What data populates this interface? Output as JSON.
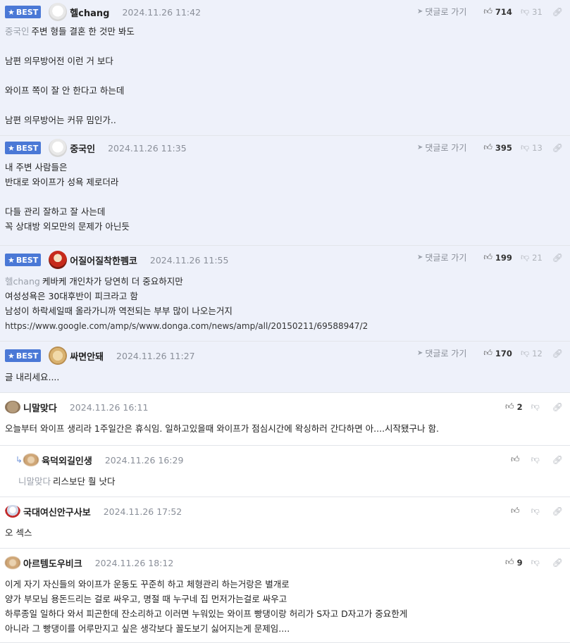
{
  "comments": [
    {
      "best": true,
      "badge": "BEST",
      "nickname": "헬chang",
      "time": "2024.11.26 11:42",
      "reply_label": "댓글로 가기",
      "up": "714",
      "down": "31",
      "avatar_icon": "white-dog-avatar",
      "lines": [
        {
          "mention": "중국인",
          "text": "주변 형들 결혼 한 것만 봐도"
        },
        {
          "mention": "",
          "text": ""
        },
        {
          "mention": "",
          "text": "남편 의무방어전 이런 거 보다"
        },
        {
          "mention": "",
          "text": ""
        },
        {
          "mention": "",
          "text": "와이프 쪽이 잘 안 한다고 하는데"
        },
        {
          "mention": "",
          "text": ""
        },
        {
          "mention": "",
          "text": "남편 의무방어는 커뮤 밈인가.."
        }
      ]
    },
    {
      "best": true,
      "badge": "BEST",
      "nickname": "중국인",
      "time": "2024.11.26 11:35",
      "reply_label": "댓글로 가기",
      "up": "395",
      "down": "13",
      "avatar_icon": "white-dog-avatar",
      "lines": [
        {
          "mention": "",
          "text": "내 주변 사람들은"
        },
        {
          "mention": "",
          "text": "반대로 와이프가 성욕 제로더라"
        },
        {
          "mention": "",
          "text": ""
        },
        {
          "mention": "",
          "text": "다들 관리 잘하고 잘 사는데"
        },
        {
          "mention": "",
          "text": "꼭 상대방 외모만의 문제가 아닌듯"
        }
      ]
    },
    {
      "best": true,
      "badge": "BEST",
      "nickname": "어질어질착한펨코",
      "time": "2024.11.26 11:55",
      "reply_label": "댓글로 가기",
      "up": "199",
      "down": "21",
      "avatar_icon": "red-hood-avatar",
      "lines": [
        {
          "mention": "헬chang",
          "text": "케바케 개인차가 당연히 더 중요하지만"
        },
        {
          "mention": "",
          "text": "여성성욕은 30대후반이 피크라고 함"
        },
        {
          "mention": "",
          "text": "남성이 하락세일때 올라가니까 역전되는 부부 많이 나오는거지"
        },
        {
          "mention": "",
          "text": "https://www.google.com/amp/s/www.donga.com/news/amp/all/20150211/69588947/2",
          "is_url": true
        }
      ]
    },
    {
      "best": true,
      "badge": "BEST",
      "nickname": "싸면안돼",
      "time": "2024.11.26 11:27",
      "reply_label": "댓글로 가기",
      "up": "170",
      "down": "12",
      "avatar_icon": "puppy-avatar",
      "lines": [
        {
          "mention": "",
          "text": "글 내리세요...."
        }
      ]
    },
    {
      "best": false,
      "nickname": "니말맞다",
      "time": "2024.11.26 16:11",
      "up": "2",
      "down": "",
      "avatar_icon": "brown-circle-avatar",
      "lines": [
        {
          "mention": "",
          "text": "오늘부터 와이프 생리라 1주일간은 휴식임. 일하고있을때 와이프가 점심시간에 왁싱하러 간다하면 아....시작됐구나 함."
        }
      ]
    },
    {
      "best": false,
      "is_reply": true,
      "nickname": "육덕외길인생",
      "time": "2024.11.26 16:29",
      "up": "",
      "down": "",
      "avatar_icon": "blurred-dog-avatar",
      "lines": [
        {
          "mention": "니말맞다",
          "text": "리스보단 훨 낫다"
        }
      ]
    },
    {
      "best": false,
      "nickname": "국대여신안구사보",
      "time": "2024.11.26 17:52",
      "up": "",
      "down": "",
      "avatar_icon": "cartoon-man-avatar",
      "lines": [
        {
          "mention": "",
          "text": "오 섹스"
        }
      ]
    },
    {
      "best": false,
      "nickname": "아르템도우비크",
      "time": "2024.11.26 18:12",
      "up": "9",
      "down": "",
      "avatar_icon": "blurred-dog-avatar",
      "lines": [
        {
          "mention": "",
          "text": "이게 자기 자신들의 와이프가 운동도 꾸준히 하고 체형관리 하는거랑은 별개로"
        },
        {
          "mention": "",
          "text": "양가 부모님 용돈드리는 걸로 싸우고, 명절 때 누구네 집 먼저가는걸로 싸우고"
        },
        {
          "mention": "",
          "text": "하루종일 일하다 와서 피곤한데 잔소리하고 이러면 누워있는 와이프 빵댕이랑 허리가 S자고 D자고가 중요한게"
        },
        {
          "mention": "",
          "text": "아니라 그 빵댕이를 어루만지고 싶은 생각보다 꼴도보기 싫어지는게 문제임...."
        }
      ]
    }
  ],
  "colors": {
    "best_bg": "#eef1fa",
    "badge_bg": "#4a78d6",
    "mention": "#9aa0aa",
    "time": "#8a8f99"
  }
}
